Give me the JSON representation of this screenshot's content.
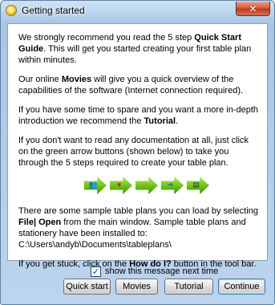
{
  "window": {
    "title": "Getting started",
    "close_glyph": "✕"
  },
  "content": {
    "p1_pre": "We strongly recommend you read the 5 step ",
    "p1_bold": "Quick Start Guide",
    "p1_post": ". This will get you started creating your first table plan within minutes.",
    "p2_pre": "Our online ",
    "p2_bold": "Movies",
    "p2_post": " will give you a quick overview of the capabilities of the software (Internet connection required).",
    "p3_pre": "If you have some time to spare and you want a more in-depth introduction we recommend the ",
    "p3_bold": "Tutorial",
    "p3_post": ".",
    "p4": "If you don't want to read any documentation at all, just click on the green arrow buttons (shown below) to take you through the 5 steps required to create your table plan.",
    "p5_pre": "There are some sample table plans you can load by selecting ",
    "p5_bold": "File| Open",
    "p5_post": " from the main window. Sample table plans and stationery have been installed to:",
    "p5_path": "C:\\Users\\andyb\\Documents\\tableplans\\",
    "p6_pre": "If you get stuck, click on the ",
    "p6_bold": "How do I?",
    "p6_post": " button in the tool bar."
  },
  "step_arrows": [
    {
      "icon": "people-icon",
      "glyph": "👥",
      "color": "#8a3fbf"
    },
    {
      "icon": "heart-icon",
      "glyph": "♥",
      "color": "#d21f2a"
    },
    {
      "icon": "table-icon",
      "glyph": "▭",
      "color": "#c08a2a"
    },
    {
      "icon": "arrow-icon",
      "glyph": "➜",
      "color": "#1e63c9"
    },
    {
      "icon": "printer-icon",
      "glyph": "▤",
      "color": "#333333"
    }
  ],
  "options": {
    "show_message_label": "show this message next time",
    "show_message_checked": true,
    "check_glyph": "✓"
  },
  "buttons": {
    "quick_start": "Quick start",
    "movies": "Movies",
    "tutorial": "Tutorial",
    "continue": "Continue"
  }
}
